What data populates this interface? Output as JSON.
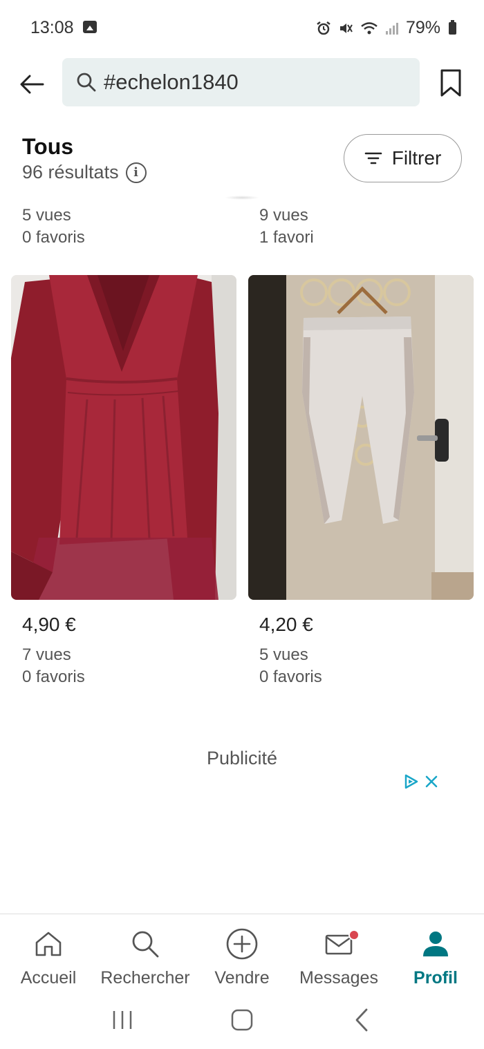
{
  "status_bar": {
    "time": "13:08",
    "battery": "79%"
  },
  "search": {
    "query": "#echelon1840"
  },
  "header": {
    "title": "Tous",
    "results_count": "96 résultats",
    "filter_label": "Filtrer"
  },
  "items_partial": [
    {
      "views": "5 vues",
      "favorites": "0 favoris"
    },
    {
      "views": "9 vues",
      "favorites": "1 favori"
    }
  ],
  "items": [
    {
      "price": "4,90 €",
      "views": "7 vues",
      "favorites": "0 favoris",
      "image_color": "#a52638"
    },
    {
      "price": "4,20 €",
      "views": "5 vues",
      "favorites": "0 favoris",
      "image_color": "#e2ddd9"
    }
  ],
  "ad": {
    "label": "Publicité"
  },
  "bottom_nav": [
    {
      "label": "Accueil",
      "icon": "home-icon"
    },
    {
      "label": "Rechercher",
      "icon": "search-icon"
    },
    {
      "label": "Vendre",
      "icon": "plus-circle-icon"
    },
    {
      "label": "Messages",
      "icon": "mail-icon"
    },
    {
      "label": "Profil",
      "icon": "profile-icon",
      "active": true
    }
  ],
  "colors": {
    "accent": "#007782",
    "search_bg": "#e9f0f0",
    "notification_dot": "#d9454f"
  }
}
